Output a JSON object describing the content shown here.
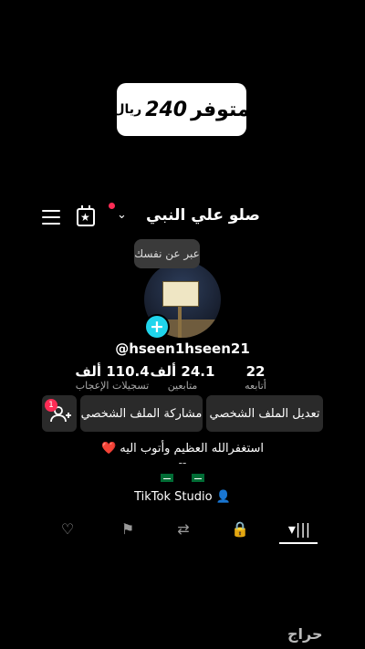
{
  "promo": {
    "word": "متوفر",
    "number": "240",
    "currency": "ريال"
  },
  "header": {
    "display_name": "صلو علي النبي"
  },
  "tooltip": {
    "text": "عبر عن نفسك"
  },
  "profile": {
    "handle": "@hseen1hseen21"
  },
  "stats": [
    {
      "value": "22",
      "label": "أتابعه"
    },
    {
      "value": "24.1 ألف",
      "label": "متابعين"
    },
    {
      "value": "110.4 ألف",
      "label": "تسجيلات الإعجاب"
    }
  ],
  "buttons": {
    "edit_profile": "تعديل الملف الشخصي",
    "share_profile": "مشاركة الملف الشخصي",
    "friend_notif_count": "1"
  },
  "bio": {
    "line1": "استغفرالله العظيم وأتوب اليه ❤️",
    "line2": "--"
  },
  "studio": {
    "label": "TikTok Studio"
  },
  "watermark": {
    "text": "حراج"
  },
  "colors": {
    "accent_red": "#fe2c55",
    "accent_cyan": "#20d5ec",
    "background": "#000000"
  }
}
